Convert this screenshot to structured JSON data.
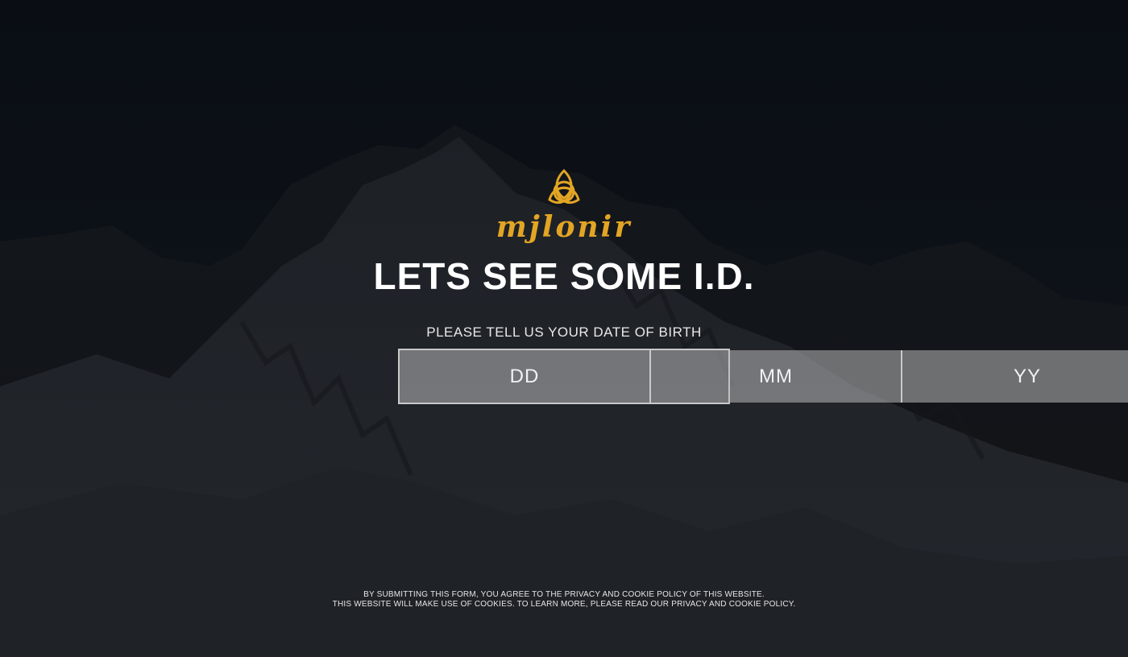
{
  "brand": {
    "name": "mjlonir",
    "emblem_icon": "triquetra-icon",
    "accent_color": "#e3a524"
  },
  "age_gate": {
    "headline": "LETS SEE SOME I.D.",
    "prompt": "PLEASE TELL US YOUR DATE OF BIRTH",
    "fields": {
      "day": {
        "placeholder": "DD",
        "value": ""
      },
      "month": {
        "placeholder": "MM",
        "value": ""
      },
      "year": {
        "placeholder": "YY",
        "value": ""
      }
    }
  },
  "legal": {
    "line1": "BY SUBMITTING THIS FORM, YOU AGREE TO THE PRIVACY AND COOKIE POLICY OF THIS WEBSITE.",
    "line2": "THIS WEBSITE WILL MAKE USE OF COOKIES. TO LEARN MORE, PLEASE READ OUR PRIVACY AND COOKIE POLICY."
  },
  "background": {
    "image": "snowy-mountain-photo",
    "base_color": "#0d1117"
  }
}
